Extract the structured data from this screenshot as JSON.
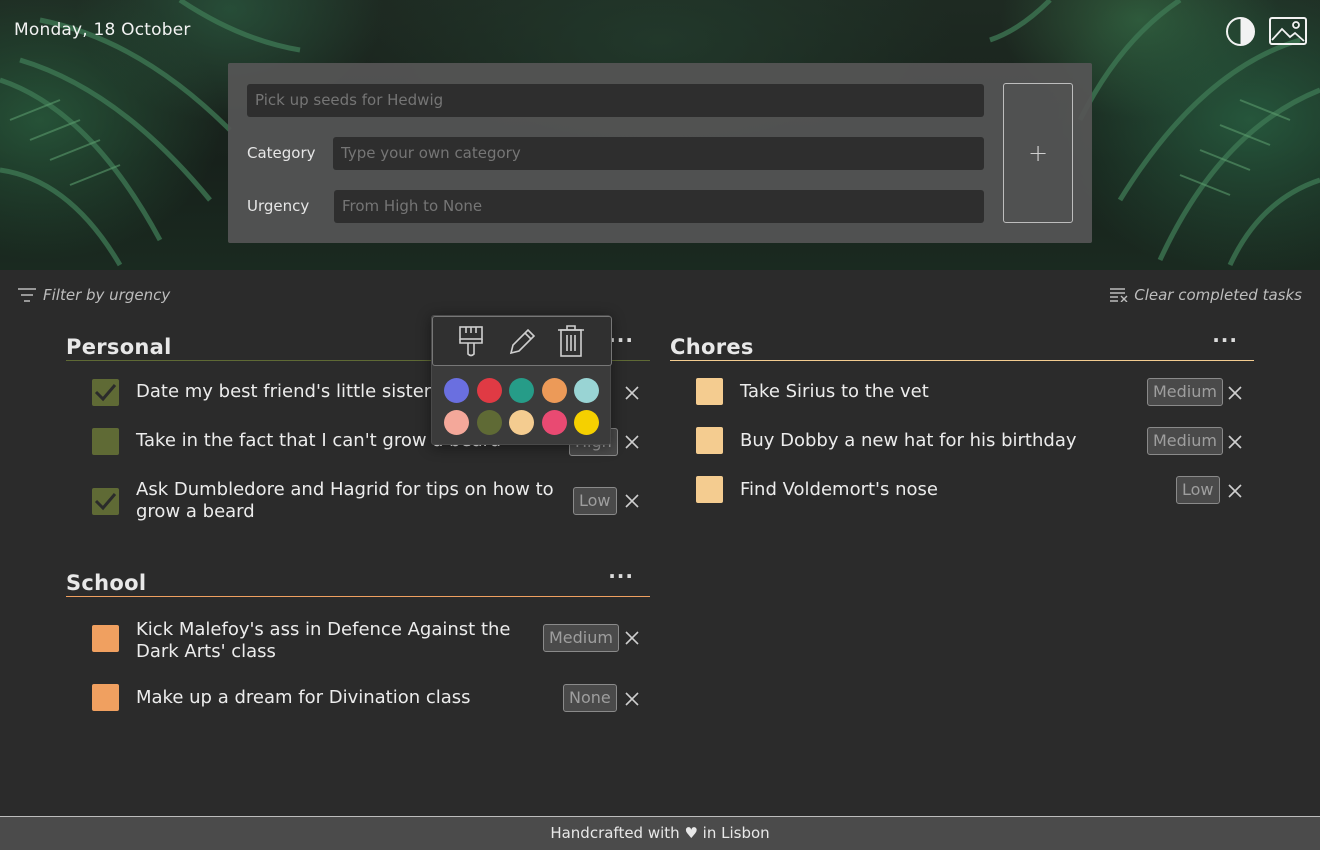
{
  "header": {
    "date": "Monday, 18 October"
  },
  "form": {
    "task_placeholder": "Pick up seeds for Hedwig",
    "category_label": "Category",
    "category_placeholder": "Type your own category",
    "urgency_label": "Urgency",
    "urgency_placeholder": "From High to None",
    "add_label": "+"
  },
  "toolbar": {
    "filter_label": "Filter by urgency",
    "clear_label": "Clear completed tasks"
  },
  "popover": {
    "tools": [
      "brush-icon",
      "pencil-icon",
      "trash-icon"
    ],
    "colors": [
      "#6a6fe0",
      "#e03a44",
      "#269c88",
      "#ec9a58",
      "#99d4d4",
      "#f4a89a",
      "#5f6a35",
      "#f4cc90",
      "#e94a72",
      "#f5d000"
    ]
  },
  "categories": [
    {
      "title": "Personal",
      "more": "···",
      "color": "#5f6a35",
      "tasks": [
        {
          "text": "Date my best friend's little sister",
          "urgency": "",
          "done": true
        },
        {
          "text": "Take in the fact that I can't grow a beard",
          "urgency": "High",
          "done": false
        },
        {
          "text": "Ask Dumbledore and Hagrid for tips on how to grow a beard",
          "urgency": "Low",
          "done": true
        }
      ]
    },
    {
      "title": "School",
      "more": "···",
      "color": "#f0a060",
      "tasks": [
        {
          "text": "Kick Malefoy's ass in Defence Against the Dark Arts' class",
          "urgency": "Medium",
          "done": false
        },
        {
          "text": "Make up a dream for Divination class",
          "urgency": "None",
          "done": false
        }
      ]
    },
    {
      "title": "Chores",
      "more": "···",
      "color": "#f4cc90",
      "tasks": [
        {
          "text": "Take Sirius to the vet",
          "urgency": "Medium",
          "done": false
        },
        {
          "text": "Buy Dobby a new hat for his birthday",
          "urgency": "Medium",
          "done": false
        },
        {
          "text": "Find Voldemort's nose",
          "urgency": "Low",
          "done": false
        }
      ]
    }
  ],
  "footer": {
    "text": "Handcrafted with ♥ in Lisbon"
  }
}
